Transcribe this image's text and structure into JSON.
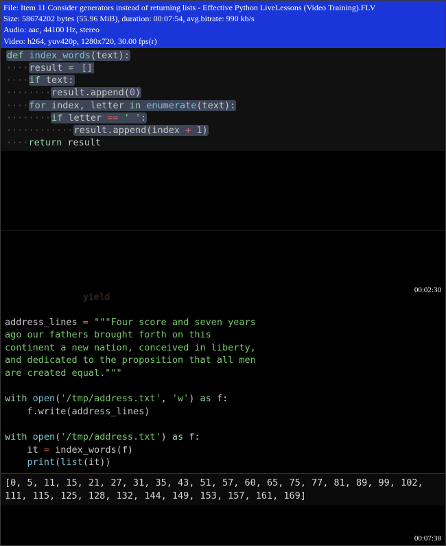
{
  "header": {
    "line1": "File: Item 11 Consider generators instead of returning lists - Effective Python LiveLessons (Video Training).FLV",
    "line2": "Size: 58674202 bytes (55.96 MiB), duration: 00:07:54, avg.bitrate: 990 kb/s",
    "line3": "Audio: aac, 44100 Hz, stereo",
    "line4": "Video: h264, yuv420p, 1280x720, 30.00 fps(r)"
  },
  "code1": {
    "l1_def": "def ",
    "l1_fn": "index_words",
    "l1_rest": "(text):",
    "l2": "result = ",
    "l2_box": "[]",
    "l3_if": "if ",
    "l3_rest": "text:",
    "l4a": "result.append(",
    "l4_num": "0",
    "l4b": ")",
    "l5_for": "for ",
    "l5_mid": "index, letter ",
    "l5_in": "in ",
    "l5_fn": "enumerate",
    "l5_rest": "(text):",
    "l6_if": "if ",
    "l6_mid": "letter ",
    "l6_op": "== ",
    "l6_str": "' '",
    "l6_c": ":",
    "l7a": "result.append(index ",
    "l7_op": "+ ",
    "l7_num": "1",
    "l7b": ")",
    "l8_ret": "return ",
    "l8_r": "result"
  },
  "ts1": "00:02:30",
  "yield_hint": "yield",
  "code2": {
    "l1a": "address_lines ",
    "l1op": "= ",
    "l1s": "\"\"\"Four score and seven years",
    "l2": "ago our fathers brought forth on this",
    "l3": "continent a new nation, conceived in liberty,",
    "l4": "and dedicated to the proposition that all men",
    "l5": "are created equal.\"\"\"",
    "l7_with": "with ",
    "l7_open": "open",
    "l7_p1": "(",
    "l7_s1": "'/tmp/address.txt'",
    "l7_c": ", ",
    "l7_s2": "'w'",
    "l7_p2": ") ",
    "l7_as": "as ",
    "l7_f": "f:",
    "l8": "f.write(address_lines)",
    "l10_with": "with ",
    "l10_open": "open",
    "l10_p1": "(",
    "l10_s1": "'/tmp/address.txt'",
    "l10_p2": ") ",
    "l10_as": "as ",
    "l10_f": "f:",
    "l11a": "it ",
    "l11op": "= ",
    "l11b": "index_words(f)",
    "l12_print": "print",
    "l12_rest": "(",
    "l12_list": "list",
    "l12_rest2": "(it))"
  },
  "output": "[0, 5, 11, 15, 21, 27, 31, 35, 43, 51, 57, 60, 65, 75, 77, 81, 89, 99, 102, 111, 115, 125, 128, 132, 144, 149, 153, 157, 161, 169]",
  "ts2": "00:07:38"
}
